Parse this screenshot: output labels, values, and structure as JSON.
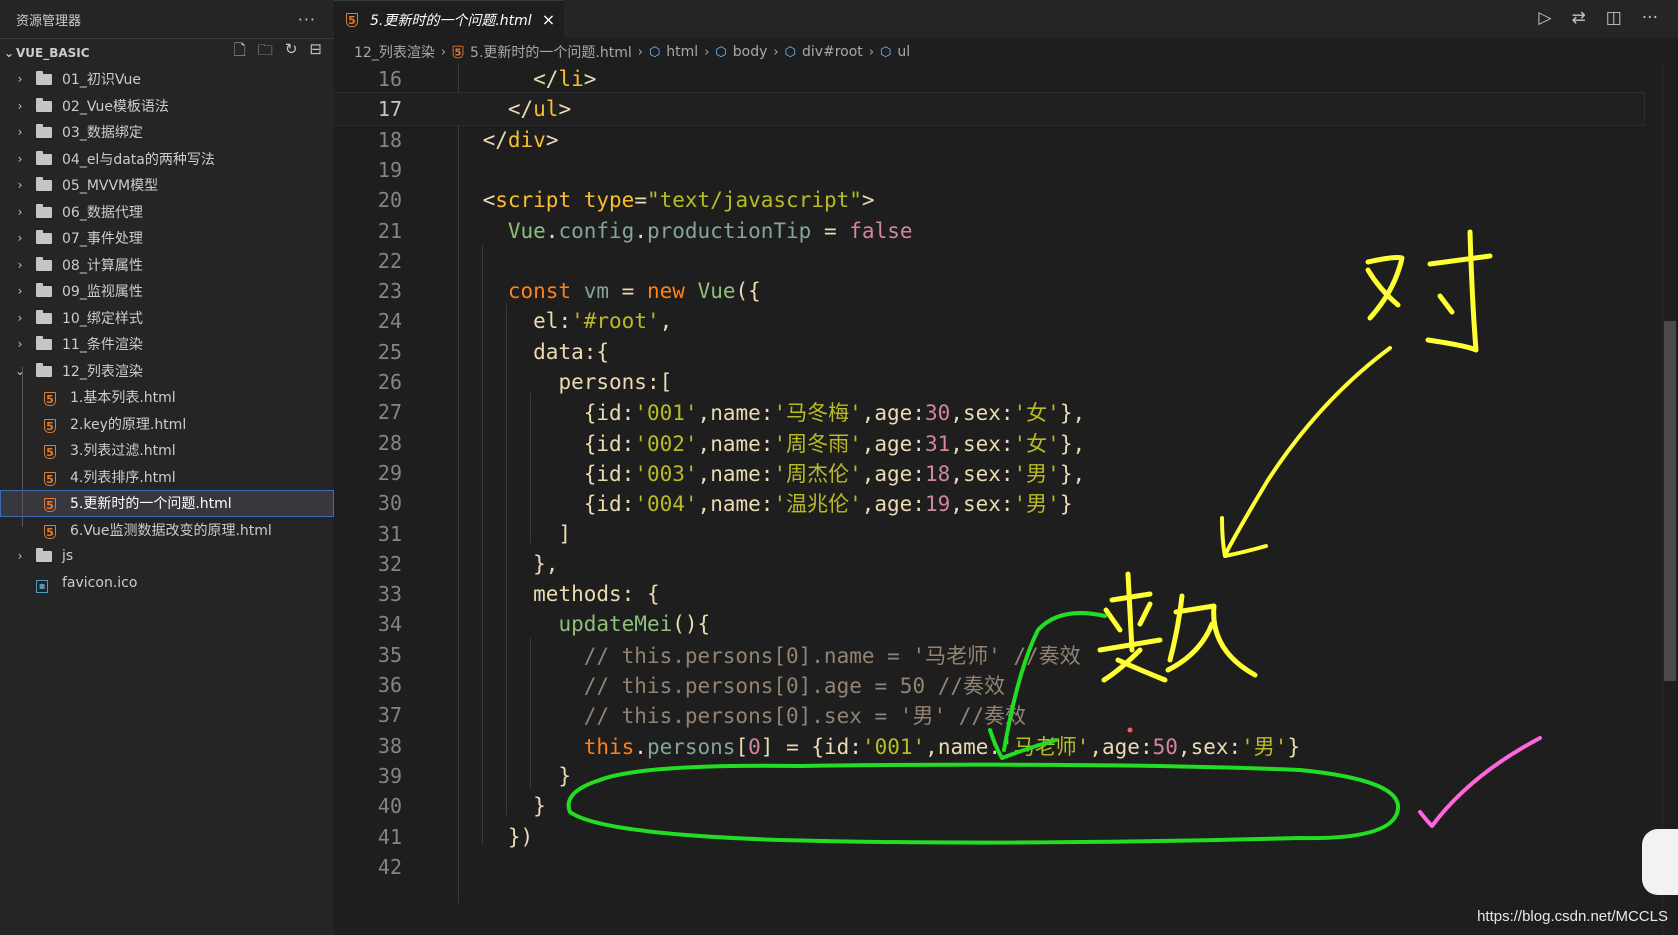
{
  "sidebar": {
    "title": "资源管理器",
    "more_icon": "ellipsis-icon",
    "section_title": "VUE_BASIC",
    "section_actions": [
      "new-file-icon",
      "new-folder-icon",
      "refresh-icon",
      "collapse-all-icon"
    ],
    "folders": [
      {
        "label": "01_初识Vue"
      },
      {
        "label": "02_Vue模板语法"
      },
      {
        "label": "03_数据绑定"
      },
      {
        "label": "04_el与data的两种写法"
      },
      {
        "label": "05_MVVM模型"
      },
      {
        "label": "06_数据代理"
      },
      {
        "label": "07_事件处理"
      },
      {
        "label": "08_计算属性"
      },
      {
        "label": "09_监视属性"
      },
      {
        "label": "10_绑定样式"
      },
      {
        "label": "11_条件渲染"
      },
      {
        "label": "12_列表渲染"
      }
    ],
    "files": [
      {
        "label": "1.基本列表.html"
      },
      {
        "label": "2.key的原理.html"
      },
      {
        "label": "3.列表过滤.html"
      },
      {
        "label": "4.列表排序.html"
      },
      {
        "label": "5.更新时的一个问题.html"
      },
      {
        "label": "6.Vue监测数据改变的原理.html"
      }
    ],
    "js_folder": "js",
    "favicon": "favicon.ico",
    "selected_file": "5.更新时的一个问题.html"
  },
  "tab": {
    "label": "5.更新时的一个问题.html",
    "close": "×",
    "actions": [
      "run-icon",
      "compare-icon",
      "split-editor-icon",
      "ellipsis-icon"
    ]
  },
  "breadcrumb": {
    "folder": "12_列表渲染",
    "file": "5.更新时的一个问题.html",
    "items": [
      "html",
      "body",
      "div#root",
      "ul"
    ]
  },
  "editor": {
    "current_line": "17",
    "line_numbers": [
      "16",
      "17",
      "18",
      "19",
      "20",
      "21",
      "22",
      "23",
      "24",
      "25",
      "26",
      "27",
      "28",
      "29",
      "30",
      "31",
      "32",
      "33",
      "34",
      "35",
      "36",
      "37",
      "38",
      "39",
      "40",
      "41",
      "42"
    ]
  },
  "annotations": {
    "handwritten_top": "对",
    "handwritten_mid": "数",
    "colors": {
      "yellow": "#ffff33",
      "green": "#22dd22",
      "pink": "#ff66dd"
    }
  },
  "watermark": "https://blog.csdn.net/MCCLS"
}
